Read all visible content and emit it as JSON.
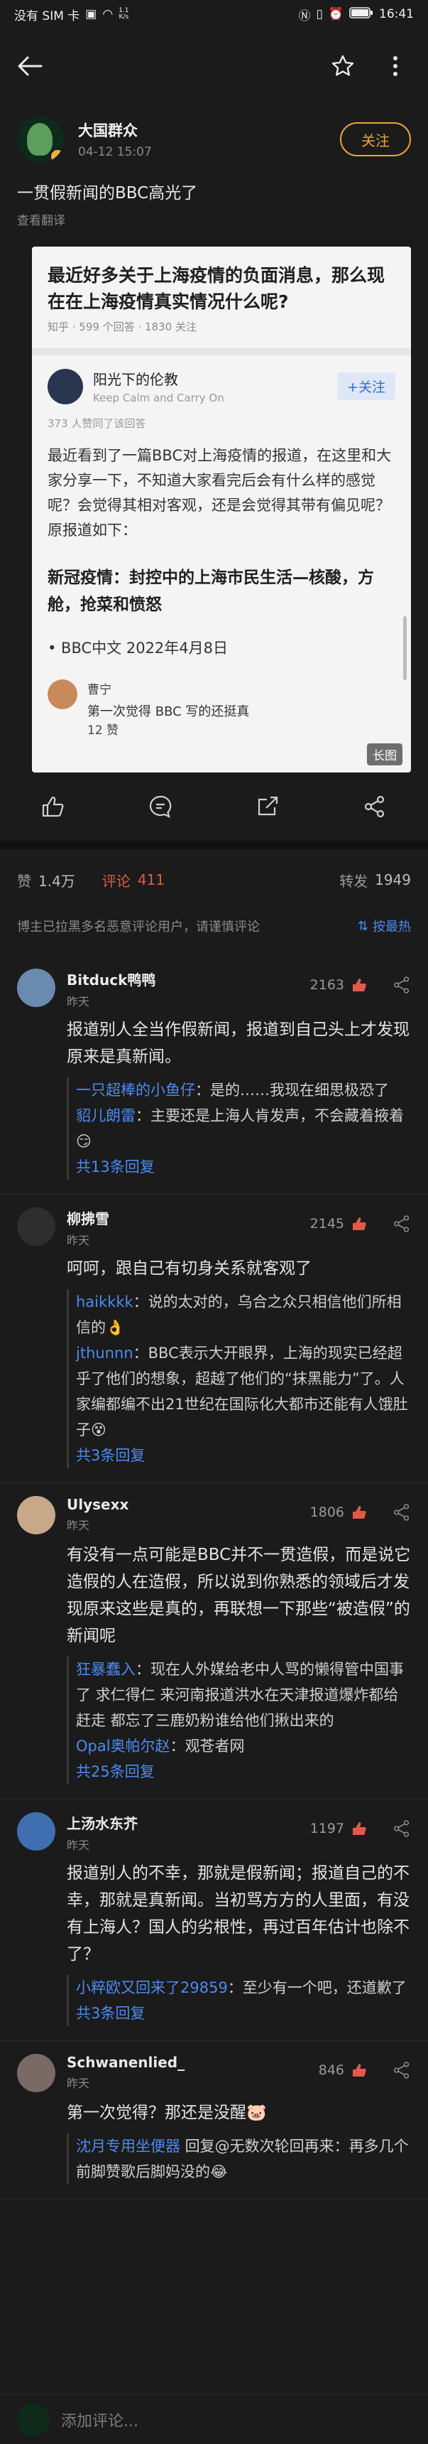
{
  "status": {
    "carrier": "没有 SIM 卡",
    "speed_value": "1.1",
    "speed_unit": "K/s",
    "battery": "100",
    "time": "16:41"
  },
  "post": {
    "author_name": "大国群众",
    "date": "04-12 15:07",
    "follow_label": "关注",
    "title": "一贯假新闻的BBC高光了",
    "translate_label": "查看翻译"
  },
  "card": {
    "question": "最近好多关于上海疫情的负面消息，那么现在在上海疫情真实情况什么呢?",
    "question_meta": "知乎 · 599 个回答 · 1830 关注",
    "answerer_name": "阳光下的伦教",
    "answerer_bio": "Keep Calm and Carry On",
    "answerer_follow": "+关注",
    "likes": "373 人赞同了该回答",
    "body": "最近看到了一篇BBC对上海疫情的报道，在这里和大家分享一下，不知道大家看完后会有什么样的感觉呢？会觉得其相对客观，还是会觉得其带有偏见呢？原报道如下：",
    "quote": "新冠疫情：封控中的上海市民生活—核酸，方舱，抢菜和愤怒",
    "source": "• BBC中文 2022年4月8日",
    "comment_name": "曹宁",
    "comment_text": "第一次觉得 BBC 写的还挺真",
    "comment_likes": "12 赞",
    "long_label": "长图"
  },
  "stats": {
    "like_label": "赞",
    "like_count": "1.4万",
    "comment_label": "评论",
    "comment_count": "411",
    "repost_label": "转发",
    "repost_count": "1949"
  },
  "notice": {
    "text": "博主已拉黑多名恶意评论用户，请谨慎评论",
    "sort_label": "按最热"
  },
  "comments": [
    {
      "name": "Bitduck鸭鸭",
      "time": "昨天",
      "likes": "2163",
      "text": "报道别人全当作假新闻，报道到自己头上才发现原来是真新闻。",
      "replies": [
        {
          "user": "一只超棒的小鱼仔",
          "text": "：是的……我现在细思极恐了"
        },
        {
          "user": "貂儿朗雷",
          "text": "：主要还是上海人肯发声，不会藏着掖着😏"
        }
      ],
      "more": "共13条回复"
    },
    {
      "name": "柳拂雪",
      "time": "昨天",
      "likes": "2145",
      "text": "呵呵，跟自己有切身关系就客观了",
      "replies": [
        {
          "user": "haikkkk",
          "text": "：说的太对的，乌合之众只相信他们所相信的👌"
        },
        {
          "user": "jthunnn",
          "text": "：BBC表示大开眼界，上海的现实已经超乎了他们的想象，超越了他们的“抹黑能力”了。人家编都编不出21世纪在国际化大都市还能有人饿肚子😵"
        }
      ],
      "more": "共3条回复"
    },
    {
      "name": "Ulysexx",
      "time": "昨天",
      "likes": "1806",
      "text": "有没有一点可能是BBC并不一贯造假，而是说它造假的人在造假，所以说到你熟悉的领域后才发现原来这些是真的，再联想一下那些“被造假”的新闻呢",
      "replies": [
        {
          "user": "狂暴蠢入",
          "text": "：现在人外媒给老中人骂的懒得管中国事了 求仁得仁 来河南报道洪水在天津报道爆炸都给赶走 都忘了三鹿奶粉谁给他们揪出来的"
        },
        {
          "user": "Opal奥帕尔赵",
          "text": "：观苍者网"
        }
      ],
      "more": "共25条回复"
    },
    {
      "name": "上汤水东芥",
      "time": "昨天",
      "likes": "1197",
      "text": "报道别人的不幸，那就是假新闻；报道自己的不幸，那就是真新闻。当初骂方方的人里面，有没有上海人？国人的劣根性，再过百年估计也除不了？",
      "replies": [
        {
          "user": "小粹欧又回来了29859",
          "text": "：至少有一个吧，还道歉了"
        }
      ],
      "more": "共3条回复"
    },
    {
      "name": "Schwanenlied_",
      "time": "昨天",
      "likes": "846",
      "text": "第一次觉得？那还是没醒🐷",
      "replies": [
        {
          "user": "沈月专用坐便器",
          "text": " 回复@无数次轮回再来：再多几个前脚赞歌后脚妈没的😂"
        }
      ],
      "more": ""
    }
  ],
  "input_placeholder": "添加评论..."
}
